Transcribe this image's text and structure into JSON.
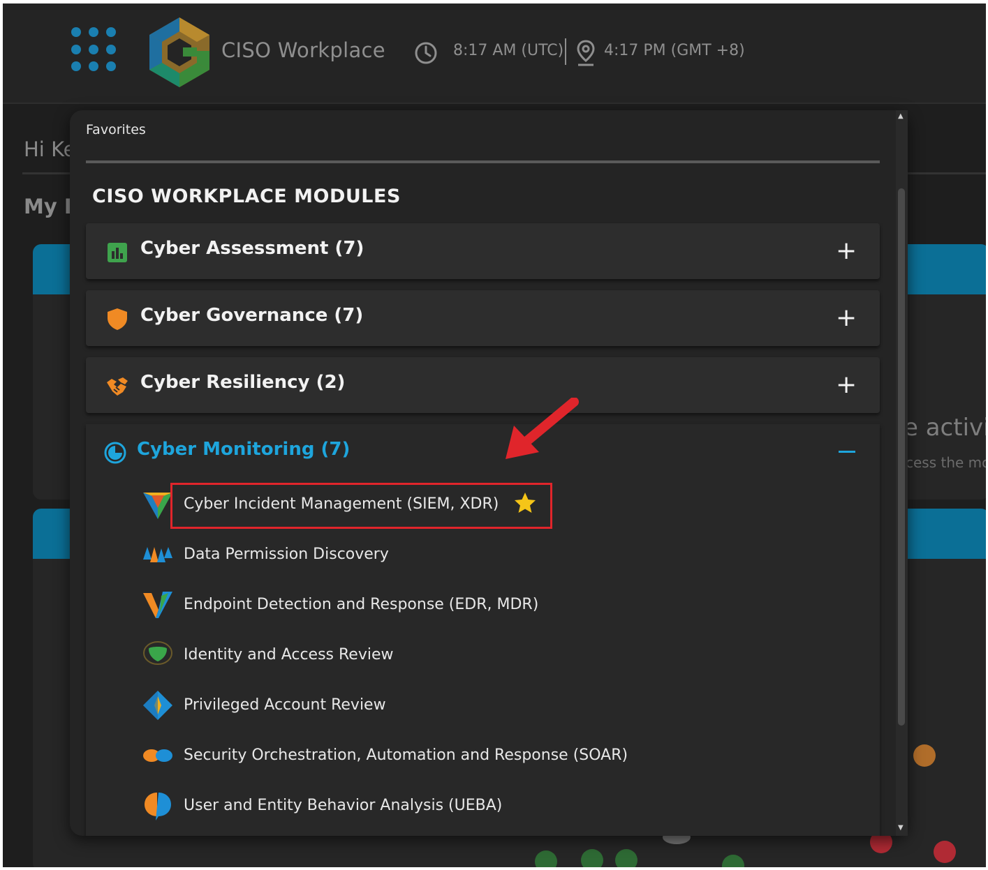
{
  "header": {
    "app_title": "CISO Workplace",
    "time_utc": "8:17 AM (UTC)",
    "time_local": "4:17 PM (GMT +8)"
  },
  "background": {
    "greeting": "Hi Ke",
    "dashboard_title": "My D",
    "activity_text": "e activit",
    "access_text": "cess the mo"
  },
  "panel": {
    "favorites_label": "Favorites",
    "modules_title": "CISO WORKPLACE MODULES",
    "sections": [
      {
        "label": "Cyber Assessment (7)",
        "icon": "bar-chart-icon",
        "color": "#3fa34d",
        "toggle": "+"
      },
      {
        "label": "Cyber Governance (7)",
        "icon": "shield-icon",
        "color": "#f08a24",
        "toggle": "+"
      },
      {
        "label": "Cyber Resiliency (2)",
        "icon": "handshake-icon",
        "color": "#f08a24",
        "toggle": "+"
      },
      {
        "label": "Cyber Monitoring (7)",
        "icon": "monitoring-icon",
        "color": "#1ea5dc",
        "toggle": "−",
        "expanded": true
      }
    ],
    "monitoring_items": [
      {
        "label": "Cyber Incident Management (SIEM, XDR)",
        "icon": "siem-icon",
        "favorite": true
      },
      {
        "label": "Data Permission Discovery",
        "icon": "data-permission-icon"
      },
      {
        "label": "Endpoint Detection and Response (EDR, MDR)",
        "icon": "edr-icon"
      },
      {
        "label": "Identity and Access Review",
        "icon": "identity-icon"
      },
      {
        "label": "Privileged Account Review",
        "icon": "privileged-icon"
      },
      {
        "label": "Security Orchestration, Automation and Response (SOAR)",
        "icon": "soar-icon"
      },
      {
        "label": "User and Entity Behavior Analysis (UEBA)",
        "icon": "ueba-icon"
      }
    ]
  },
  "colors": {
    "accent": "#1ea5dc",
    "highlight": "#e0252b",
    "star": "#f5c518"
  }
}
